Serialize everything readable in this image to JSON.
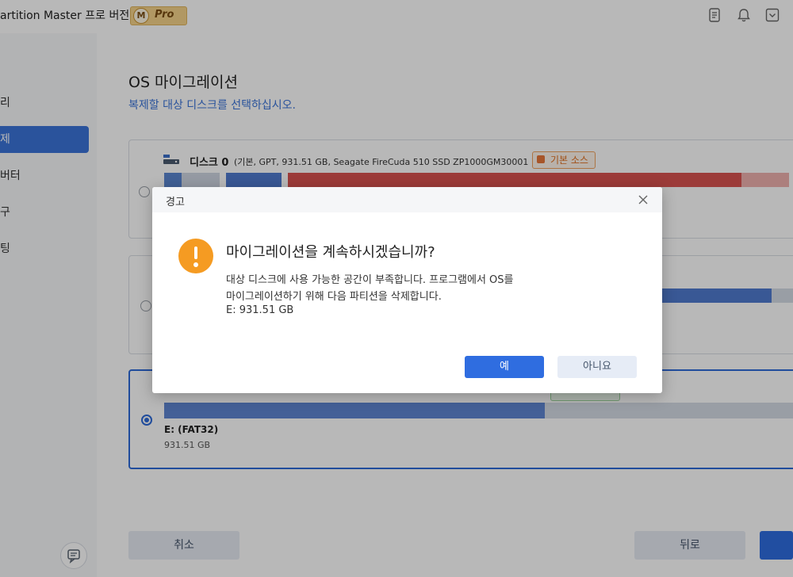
{
  "titlebar": {
    "app_title": "artition Master 프로 버전",
    "pro_badge_letter": "M",
    "pro_badge_text": "Pro",
    "icons": [
      "notes-icon",
      "bell-icon",
      "menu-dropdown-icon"
    ]
  },
  "sidebar": {
    "items": [
      {
        "label": "리",
        "active": false
      },
      {
        "label": "제",
        "active": true
      },
      {
        "label": "버터",
        "active": false
      },
      {
        "label": "구",
        "active": false
      },
      {
        "label": "팅",
        "active": false
      }
    ],
    "feedback_icon": "feedback-icon"
  },
  "main": {
    "title": "OS 마이그레이션",
    "subtitle": "복제할 대상 디스크를 선택하십시오.",
    "disk0": {
      "name": "디스크 0",
      "info": "(기본, GPT, 931.51 GB, Seagate FireCuda 510 SSD ZP1000GM30001 )",
      "source_badge": "기본 소스",
      "selected": false
    },
    "disk2": {
      "selected": true,
      "used_fraction": 0.6,
      "partition_label": "E: (FAT32)",
      "partition_size": "931.51 GB"
    }
  },
  "footer": {
    "cancel": "취소",
    "back": "뒤로"
  },
  "dialog": {
    "title": "경고",
    "heading": "마이그레이션을 계속하시겠습니까?",
    "message_line1": "대상 디스크에 사용 가능한 공간이 부족합니다. 프로그램에서 OS를",
    "message_line2": "마이그레이션하기 위해 다음 파티션을 삭제합니다.",
    "message_line3": "E: 931.51 GB",
    "yes": "예",
    "no": "아니요"
  },
  "colors": {
    "accent": "#2f6de0",
    "warning": "#f59b22",
    "partition_blue": "#6b8fd3",
    "partition_red": "#d9534f"
  }
}
